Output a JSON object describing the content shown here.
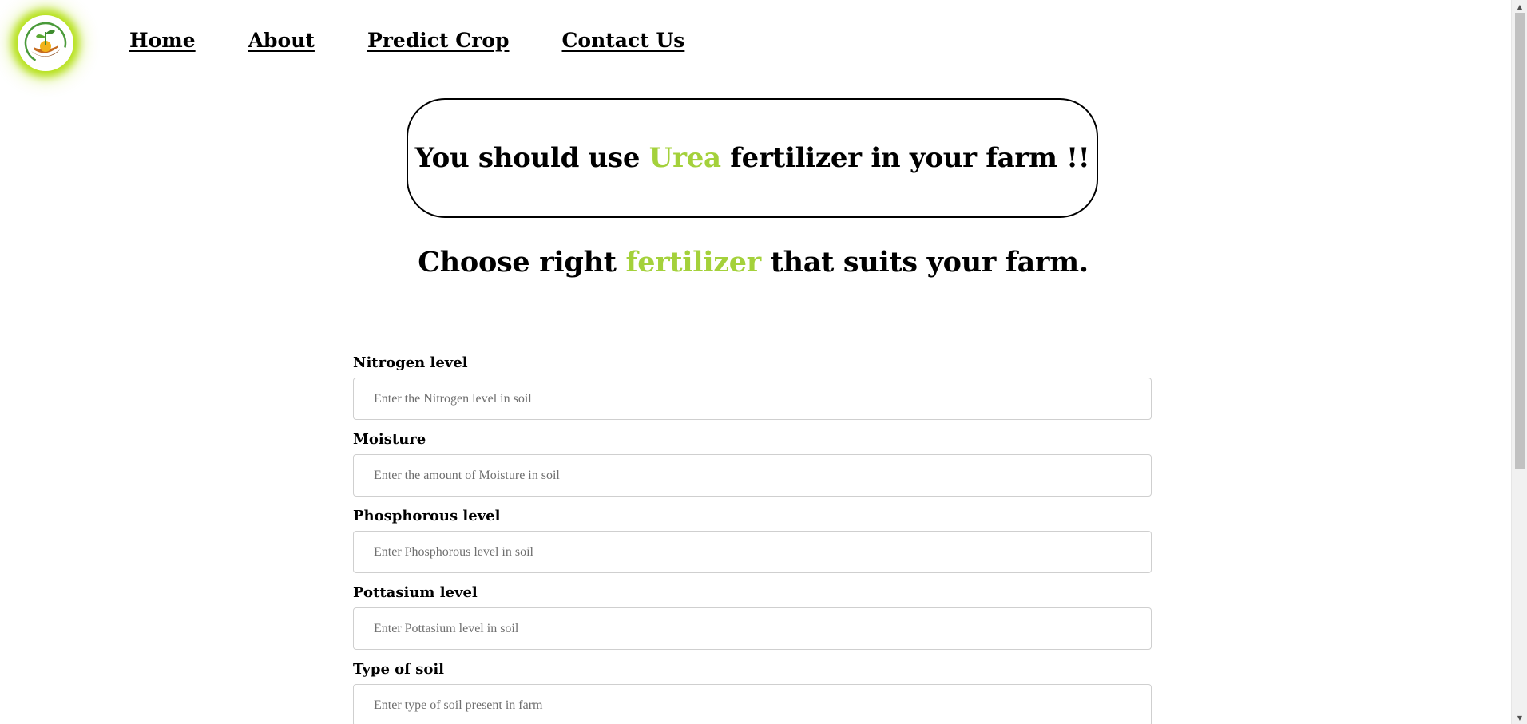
{
  "nav": {
    "logo_icon": "plant-sun-logo-icon",
    "items": [
      {
        "label": "Home"
      },
      {
        "label": "About"
      },
      {
        "label": "Predict Crop"
      },
      {
        "label": "Contact Us"
      }
    ]
  },
  "result": {
    "prefix": "You should use ",
    "fertilizer": "Urea",
    "suffix": " fertilizer in your farm !!"
  },
  "subtitle": {
    "prefix": "Choose right ",
    "highlight": "fertilizer",
    "suffix": " that suits your farm."
  },
  "form": {
    "fields": [
      {
        "label": "Nitrogen level",
        "placeholder": "Enter the Nitrogen level in soil",
        "value": ""
      },
      {
        "label": "Moisture",
        "placeholder": "Enter the amount of Moisture in soil",
        "value": ""
      },
      {
        "label": "Phosphorous level",
        "placeholder": "Enter Phosphorous level in soil",
        "value": ""
      },
      {
        "label": "Pottasium level",
        "placeholder": "Enter Pottasium level in soil",
        "value": ""
      },
      {
        "label": "Type of soil",
        "placeholder": "Enter type of soil present in farm",
        "value": ""
      }
    ]
  },
  "colors": {
    "accent": "#a4d13b",
    "logo_glow": "#b6e11a",
    "text": "#000000"
  }
}
